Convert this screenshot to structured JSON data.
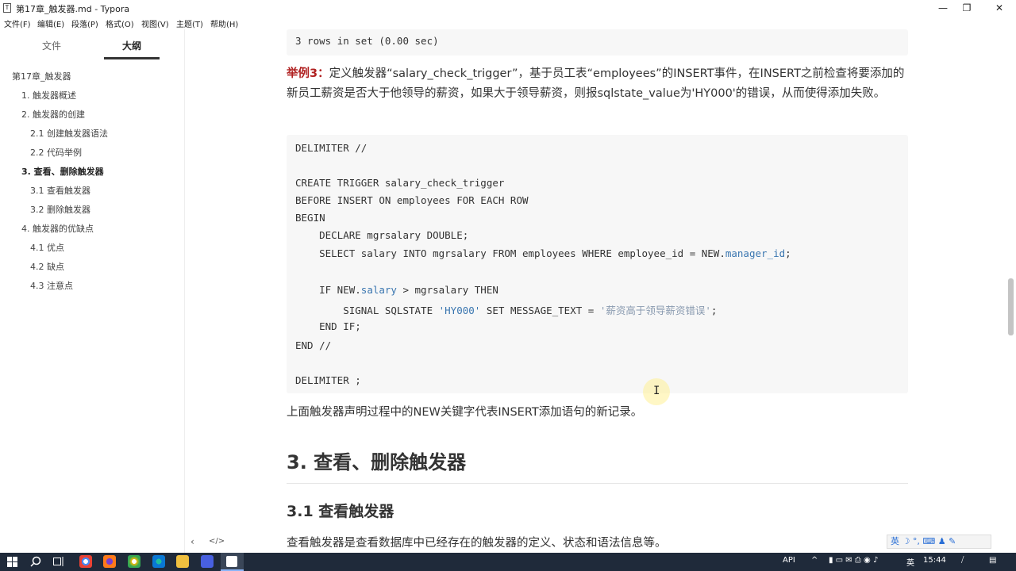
{
  "window": {
    "title": "第17章_触发器.md - Typora",
    "minimize": "—",
    "maximize": "❐",
    "close": "✕"
  },
  "menu": [
    "文件(F)",
    "编辑(E)",
    "段落(P)",
    "格式(O)",
    "视图(V)",
    "主题(T)",
    "帮助(H)"
  ],
  "sidebar": {
    "tab_files": "文件",
    "tab_outline": "大纲",
    "toc": [
      {
        "label": "第17章_触发器",
        "level": 0
      },
      {
        "label": "1. 触发器概述",
        "level": 1
      },
      {
        "label": "2. 触发器的创建",
        "level": 1
      },
      {
        "label": "2.1 创建触发器语法",
        "level": 2
      },
      {
        "label": "2.2 代码举例",
        "level": 2
      },
      {
        "label": "3. 查看、删除触发器",
        "level": 1,
        "active": true
      },
      {
        "label": "3.1 查看触发器",
        "level": 2
      },
      {
        "label": "3.2 删除触发器",
        "level": 2
      },
      {
        "label": "4. 触发器的优缺点",
        "level": 1
      },
      {
        "label": "4.1 优点",
        "level": 2
      },
      {
        "label": "4.2 缺点",
        "level": 2
      },
      {
        "label": "4.3 注意点",
        "level": 2
      }
    ],
    "footer_left": "‹",
    "footer_right": "</>"
  },
  "content": {
    "result_line": "3 rows in set (0.00 sec)",
    "example_label": "举例3：",
    "example_text": "定义触发器“salary_check_trigger”，基于员工表“employees”的INSERT事件，在INSERT之前检查将要添加的新员工薪资是否大于他领导的薪资，如果大于领导薪资，则报sqlstate_value为'HY000'的错误，从而使得添加失败。",
    "code": {
      "l1": "DELIMITER //",
      "l2": "CREATE TRIGGER salary_check_trigger",
      "l3": "BEFORE INSERT ON employees FOR EACH ROW",
      "l4": "BEGIN",
      "l5": "    DECLARE mgrsalary DOUBLE;",
      "l6a": "    SELECT salary INTO mgrsalary FROM employees WHERE employee_id = NEW.",
      "l6b": "manager_id",
      "l6c": ";",
      "l7a": "    IF NEW.",
      "l7b": "salary",
      "l7c": " > mgrsalary THEN",
      "l8a": "        SIGNAL SQLSTATE ",
      "l8b": "'HY000'",
      "l8c": " SET MESSAGE_TEXT = ",
      "l8d": "'薪资高于领导薪资错误'",
      "l8e": ";",
      "l9": "    END IF;",
      "l10": "END //",
      "l11": "DELIMITER ;"
    },
    "after_code": "上面触发器声明过程中的NEW关键字代表INSERT添加语句的新记录。",
    "h2": "3. 查看、删除触发器",
    "h3": "3.1 查看触发器",
    "bottom_para": "查看触发器是查看数据库中已经存在的触发器的定义、状态和语法信息等。"
  },
  "ime": "英 ☽ °, ⌨ ♟ ✎",
  "taskbar": {
    "api": "API",
    "lang": "英",
    "time": "15:44"
  }
}
